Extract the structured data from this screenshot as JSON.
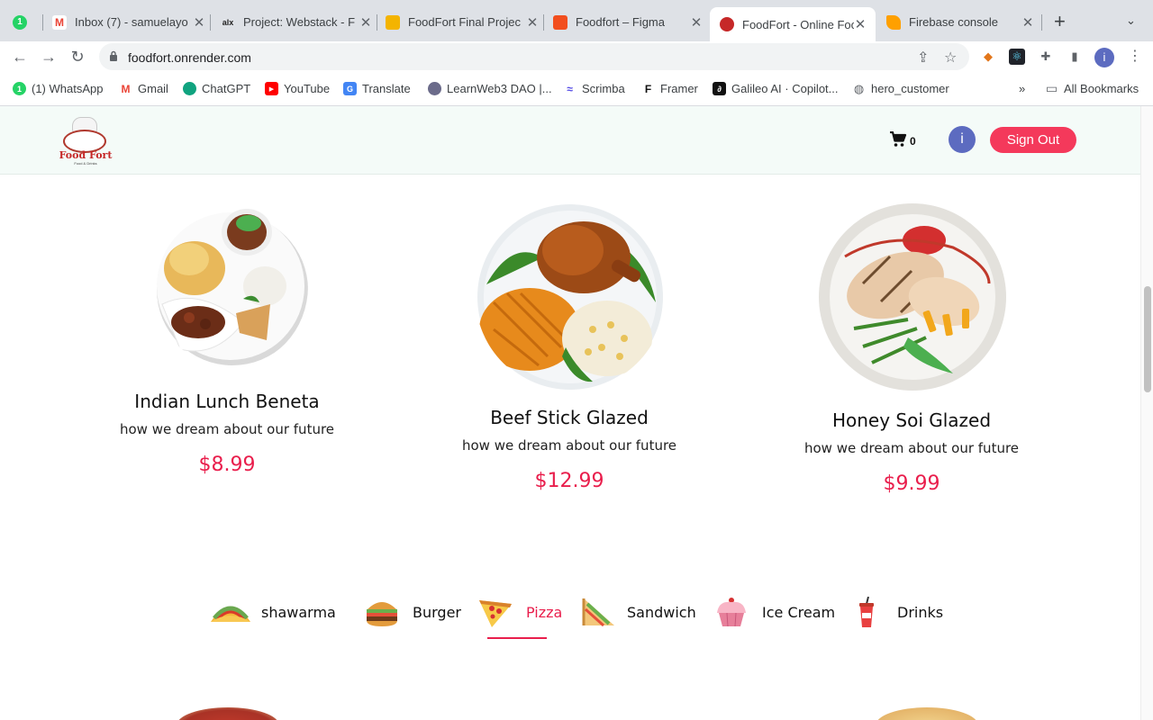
{
  "browser": {
    "tabs": [
      {
        "title": "",
        "icon": "whatsapp-icon"
      },
      {
        "title": "Inbox (7) - samuelayo",
        "icon": "gmail-icon"
      },
      {
        "title": "Project: Webstack - F",
        "icon": "alx-icon"
      },
      {
        "title": "FoodFort Final Projec",
        "icon": "slides-icon"
      },
      {
        "title": "Foodfort – Figma",
        "icon": "figma-icon"
      },
      {
        "title": "FoodFort - Online Foo",
        "icon": "foodfort-icon"
      },
      {
        "title": "Firebase console",
        "icon": "firebase-icon"
      }
    ],
    "new_tab": "+",
    "url": "foodfort.onrender.com",
    "profile_initial": "i",
    "bookmarks": [
      {
        "label": "(1) WhatsApp",
        "icon": "whatsapp-icon"
      },
      {
        "label": "Gmail",
        "icon": "gmail-icon"
      },
      {
        "label": "ChatGPT",
        "icon": "chatgpt-icon"
      },
      {
        "label": "YouTube",
        "icon": "youtube-icon"
      },
      {
        "label": "Translate",
        "icon": "translate-icon"
      },
      {
        "label": "LearnWeb3 DAO |...",
        "icon": "learnweb3-icon"
      },
      {
        "label": "Scrimba",
        "icon": "scrimba-icon"
      },
      {
        "label": "Framer",
        "icon": "framer-icon"
      },
      {
        "label": "Galileo AI · Copilot...",
        "icon": "galileo-icon"
      },
      {
        "label": "hero_customer",
        "icon": "globe-icon"
      }
    ],
    "overflow": "»",
    "all_bookmarks": "All Bookmarks"
  },
  "header": {
    "logo_text": "Food Fort",
    "logo_tagline": "Food & Drinks",
    "cart_count": "0",
    "avatar_initial": "i",
    "signout_label": "Sign Out"
  },
  "dishes": [
    {
      "name": "Indian Lunch Beneta",
      "desc": "how we dream about our future",
      "price": "$8.99"
    },
    {
      "name": "Beef Stick Glazed",
      "desc": "how we dream about our future",
      "price": "$12.99"
    },
    {
      "name": "Honey Soi Glazed",
      "desc": "how we dream about our future",
      "price": "$9.99"
    }
  ],
  "categories": [
    {
      "label": "shawarma",
      "icon": "taco-icon",
      "active": false
    },
    {
      "label": "Burger",
      "icon": "burger-icon",
      "active": false
    },
    {
      "label": "Pizza",
      "icon": "pizza-icon",
      "active": true
    },
    {
      "label": "Sandwich",
      "icon": "sandwich-icon",
      "active": false
    },
    {
      "label": "Ice Cream",
      "icon": "cupcake-icon",
      "active": false
    },
    {
      "label": "Drinks",
      "icon": "drink-icon",
      "active": false
    }
  ],
  "colors": {
    "accent": "#e91e4c",
    "signout": "#f4395b",
    "header_bg": "#f4fbf8",
    "avatar": "#5c6bc0"
  }
}
